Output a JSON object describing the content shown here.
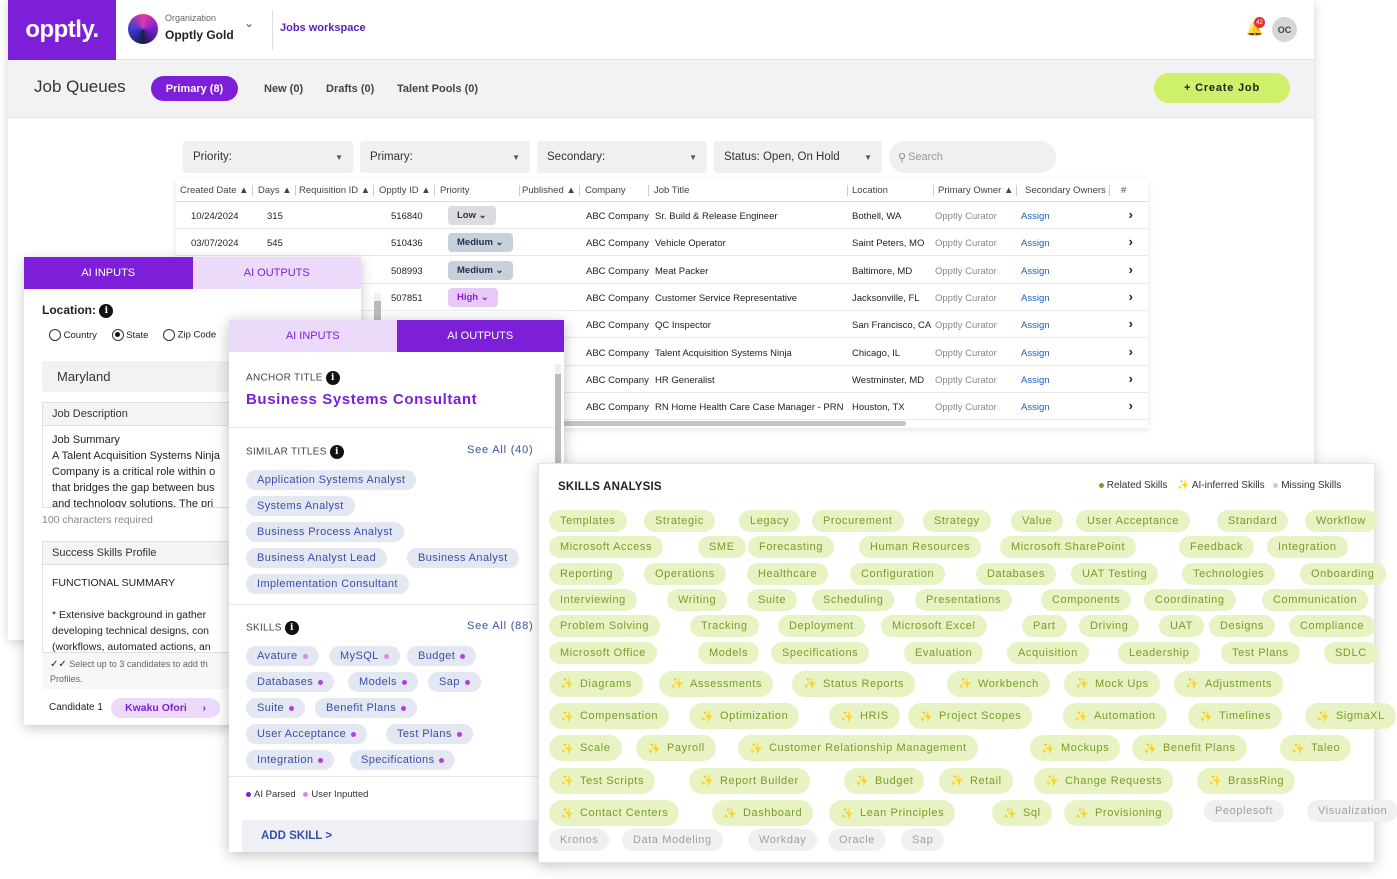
{
  "header": {
    "logo": "opptly.",
    "org_label": "Organization",
    "org_name": "Opptly Gold",
    "workspace": "Jobs workspace",
    "notif_count": "42",
    "user_initials": "OC"
  },
  "queues": {
    "title": "Job Queues",
    "tabs": [
      "Primary (8)",
      "New (0)",
      "Drafts (0)",
      "Talent Pools (0)"
    ],
    "create_label": "+ Create Job"
  },
  "filters": {
    "priority": "Priority:",
    "primary": "Primary:",
    "secondary": "Secondary:",
    "status": "Status: Open, On Hold",
    "search_placeholder": "Search"
  },
  "table": {
    "columns": [
      "Created Date",
      "Days",
      "Requisition ID",
      "Opptly ID",
      "Priority",
      "Published",
      "Company",
      "Job Title",
      "Location",
      "Primary Owner",
      "Secondary Owners",
      "#"
    ],
    "rows": [
      {
        "created": "10/24/2024",
        "days": "315",
        "opptly_id": "516840",
        "priority": "Low",
        "company": "ABC Company",
        "title": "Sr. Build & Release Engineer",
        "location": "Bothell, WA",
        "owner": "Opptly Curator",
        "secondary": "Assign"
      },
      {
        "created": "03/07/2024",
        "days": "545",
        "opptly_id": "510436",
        "priority": "Medium",
        "company": "ABC Company",
        "title": "Vehicle Operator",
        "location": "Saint Peters, MO",
        "owner": "Opptly Curator",
        "secondary": "Assign"
      },
      {
        "created": "",
        "days": "",
        "opptly_id": "508993",
        "priority": "Medium",
        "company": "ABC Company",
        "title": "Meat Packer",
        "location": "Baltimore, MD",
        "owner": "Opptly Curator",
        "secondary": "Assign"
      },
      {
        "created": "",
        "days": "",
        "opptly_id": "507851",
        "priority": "High",
        "company": "ABC Company",
        "title": "Customer Service Representative",
        "location": "Jacksonville, FL",
        "owner": "Opptly Curator",
        "secondary": "Assign"
      },
      {
        "created": "",
        "days": "",
        "opptly_id": "",
        "priority": "",
        "company": "ABC Company",
        "title": "QC Inspector",
        "location": "San Francisco, CA",
        "owner": "Opptly Curator",
        "secondary": "Assign"
      },
      {
        "created": "",
        "days": "",
        "opptly_id": "",
        "priority": "",
        "company": "ABC Company",
        "title": "Talent Acquisition Systems Ninja",
        "location": "Chicago, IL",
        "owner": "Opptly Curator",
        "secondary": "Assign"
      },
      {
        "created": "",
        "days": "",
        "opptly_id": "",
        "priority": "",
        "company": "ABC Company",
        "title": "HR Generalist",
        "location": "Westminster, MD",
        "owner": "Opptly Curator",
        "secondary": "Assign"
      },
      {
        "created": "",
        "days": "",
        "opptly_id": "",
        "priority": "",
        "company": "ABC Company",
        "title": "RN Home Health Care Case Manager - PRN",
        "location": "Houston, TX",
        "owner": "Opptly Curator",
        "secondary": "Assign"
      }
    ],
    "priority_colors": {
      "Low": "#dcdce0",
      "Medium": "#c8d0dc",
      "High": "#e8c8f6"
    }
  },
  "inputs_panel": {
    "tab_inputs": "AI INPUTS",
    "tab_outputs": "AI OUTPUTS",
    "location_label": "Location:",
    "radio_options": [
      "Country",
      "State",
      "Zip Code"
    ],
    "selected_radio": "State",
    "location_value": "Maryland",
    "job_desc_header": "Job Description",
    "job_desc_lines": [
      "Job Summary",
      "A Talent Acquisition Systems Ninja",
      "Company is a critical role within o",
      "that bridges the gap between bus",
      "and technology solutions. The pri"
    ],
    "chars_note": "100 characters required",
    "success_header": "Success Skills Profile",
    "functional_summary": "FUNCTIONAL SUMMARY",
    "profile_lines": [
      "* Extensive background in gather",
      "developing technical designs, con",
      "(workflows, automated actions, an"
    ],
    "select_note_1": "Select up to 3 candidates to add th",
    "select_note_2": "Profiles.",
    "candidate_label": "Candidate 1",
    "candidate_name": "Kwaku Ofori"
  },
  "outputs_panel": {
    "tab_inputs": "AI INPUTS",
    "tab_outputs": "AI OUTPUTS",
    "anchor_label": "ANCHOR TITLE",
    "anchor_title": "Business Systems Consultant",
    "similar_label": "SIMILAR TITLES",
    "similar_see_all": "See All (40)",
    "similar_titles": [
      "Application Systems Analyst",
      "Systems Analyst",
      "Business Process Analyst",
      "Business Analyst Lead",
      "Business Analyst",
      "Implementation Consultant"
    ],
    "skills_label": "SKILLS",
    "skills_see_all": "See All (88)",
    "skills": [
      "Avature",
      "MySQL",
      "Budget",
      "Databases",
      "Models",
      "Sap",
      "Suite",
      "Benefit Plans",
      "User Acceptance",
      "Test Plans",
      "Integration",
      "Specifications"
    ],
    "legend_parsed": "AI Parsed",
    "legend_user": "User Inputted",
    "add_skill": "ADD SKILL >"
  },
  "skills_analysis": {
    "title": "SKILLS ANALYSIS",
    "legend_related": "Related Skills",
    "legend_ai": "AI-inferred Skills",
    "legend_missing": "Missing Skills",
    "colors": {
      "related_bg": "#e7f3c2",
      "related_text": "#7d9a2a",
      "missing_bg": "#f0f0f0",
      "missing_text": "#a0a0a0"
    },
    "related": [
      [
        "Templates",
        "Strategic",
        "Legacy",
        "Procurement",
        "Strategy",
        "Value",
        "User Acceptance",
        "Standard",
        "Workflow"
      ],
      [
        "Microsoft Access",
        "SME",
        "Forecasting",
        "Human Resources",
        "Microsoft SharePoint",
        "Feedback",
        "Integration"
      ],
      [
        "Reporting",
        "Operations",
        "Healthcare",
        "Configuration",
        "Databases",
        "UAT Testing",
        "Technologies",
        "Onboarding"
      ],
      [
        "Interviewing",
        "Writing",
        "Suite",
        "Scheduling",
        "Presentations",
        "Components",
        "Coordinating",
        "Communication"
      ],
      [
        "Problem Solving",
        "Tracking",
        "Deployment",
        "Microsoft Excel",
        "Part",
        "Driving",
        "UAT",
        "Designs",
        "Compliance"
      ],
      [
        "Microsoft Office",
        "Models",
        "Specifications",
        "Evaluation",
        "Acquisition",
        "Leadership",
        "Test Plans",
        "SDLC"
      ]
    ],
    "ai_inferred": [
      [
        "Diagrams",
        "Assessments",
        "Status Reports",
        "Workbench",
        "Mock Ups",
        "Adjustments"
      ],
      [
        "Compensation",
        "Optimization",
        "HRIS",
        "Project Scopes",
        "Automation",
        "Timelines",
        "SigmaXL"
      ],
      [
        "Scale",
        "Payroll",
        "Customer Relationship Management",
        "Mockups",
        "Benefit Plans",
        "Taleo"
      ],
      [
        "Test Scripts",
        "Report Builder",
        "Budget",
        "Retail",
        "Change Requests",
        "BrassRing"
      ],
      [
        "Contact Centers",
        "Dashboard",
        "Lean Principles",
        "Sql",
        "Provisioning"
      ]
    ],
    "missing_row5": [
      "Peoplesoft",
      "Visualization"
    ],
    "missing_last": [
      "Kronos",
      "Data Modeling",
      "Workday",
      "Oracle",
      "Sap"
    ]
  }
}
